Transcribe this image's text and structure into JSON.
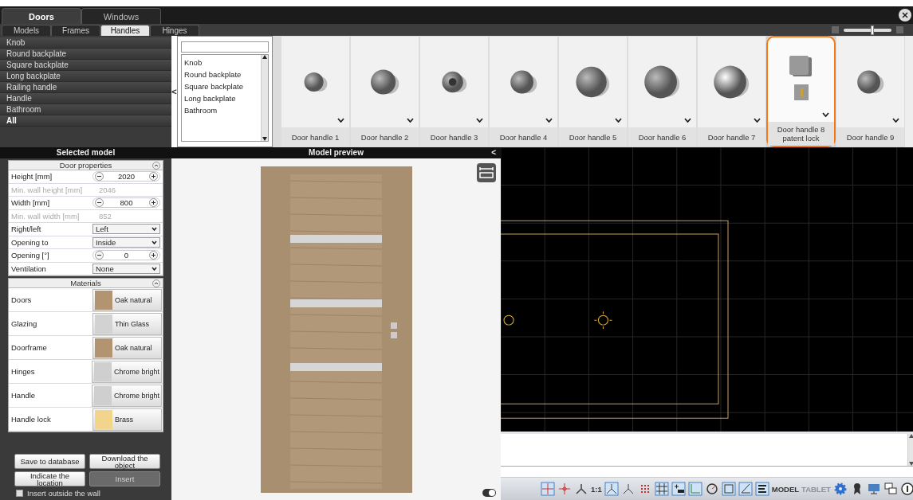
{
  "main_tabs": [
    {
      "label": "Doors",
      "selected": true
    },
    {
      "label": "Windows",
      "selected": false
    }
  ],
  "sub_tabs": [
    {
      "label": "Models",
      "selected": false
    },
    {
      "label": "Frames",
      "selected": false
    },
    {
      "label": "Handles",
      "selected": true
    },
    {
      "label": "Hinges",
      "selected": false
    }
  ],
  "thumbnail_size": {
    "level": 0.6
  },
  "categories": [
    {
      "label": "Knob",
      "selected": false
    },
    {
      "label": "Round backplate",
      "selected": false
    },
    {
      "label": "Square backplate",
      "selected": false
    },
    {
      "label": "Long backplate",
      "selected": false
    },
    {
      "label": "Railing handle",
      "selected": false
    },
    {
      "label": "Handle",
      "selected": false
    },
    {
      "label": "Bathroom",
      "selected": false
    },
    {
      "label": "All",
      "selected": true
    }
  ],
  "filter": {
    "collapse": "<",
    "items": [
      "Knob",
      "Round backplate",
      "Square backplate",
      "Long backplate",
      "Bathroom"
    ]
  },
  "handles": [
    {
      "label": "Door handle 1",
      "selected": false
    },
    {
      "label": "Door handle 2",
      "selected": false
    },
    {
      "label": "Door handle 3",
      "selected": false
    },
    {
      "label": "Door handle 4",
      "selected": false
    },
    {
      "label": "Door handle 5",
      "selected": false
    },
    {
      "label": "Door handle 6",
      "selected": false
    },
    {
      "label": "Door handle 7",
      "selected": false
    },
    {
      "label": "Door handle 8",
      "sublabel": "patent lock",
      "selected": true
    },
    {
      "label": "Door handle 9",
      "selected": false
    }
  ],
  "selected_model": {
    "title": "Selected model",
    "properties": {
      "title": "Door properties",
      "rows": [
        {
          "kind": "spinner",
          "label": "Height [mm]",
          "value": "2020"
        },
        {
          "kind": "readonly",
          "label": "Min. wall height [mm]",
          "value": "2046"
        },
        {
          "kind": "spinner",
          "label": "Width [mm]",
          "value": "800"
        },
        {
          "kind": "readonly",
          "label": "Min. wall width [mm]",
          "value": "852"
        },
        {
          "kind": "select",
          "label": "Right/left",
          "value": "Left"
        },
        {
          "kind": "select",
          "label": "Opening to",
          "value": "Inside"
        },
        {
          "kind": "spinner",
          "label": "Opening [°]",
          "value": "0"
        },
        {
          "kind": "select",
          "label": "Ventilation",
          "value": "None"
        }
      ]
    },
    "materials": {
      "title": "Materials",
      "rows": [
        {
          "label": "Doors",
          "value": "Oak natural",
          "color": "#b39471"
        },
        {
          "label": "Glazing",
          "value": "Thin Glass",
          "color": "#d2d2d2"
        },
        {
          "label": "Doorframe",
          "value": "Oak natural",
          "color": "#b39471"
        },
        {
          "label": "Hinges",
          "value": "Chrome bright",
          "color": "#cfcfcf"
        },
        {
          "label": "Handle",
          "value": "Chrome bright",
          "color": "#cfcfcf"
        },
        {
          "label": "Handle lock",
          "value": "Brass",
          "color": "#f2d58c"
        }
      ]
    },
    "buttons": [
      {
        "label": "Save to database",
        "disabled": false
      },
      {
        "label": "Download the object",
        "disabled": false
      },
      {
        "label": "Indicate the location",
        "disabled": false
      },
      {
        "label": "Insert",
        "disabled": true
      }
    ],
    "insert_outside": {
      "label": "Insert outside the wall",
      "checked": false
    }
  },
  "preview": {
    "title": "Model preview",
    "collapse": "<",
    "toggle_on": true
  },
  "status_bar": {
    "scale": "1:1",
    "modes": [
      {
        "label": "MODEL",
        "disabled": false
      },
      {
        "label": "TABLET",
        "disabled": true
      }
    ]
  }
}
